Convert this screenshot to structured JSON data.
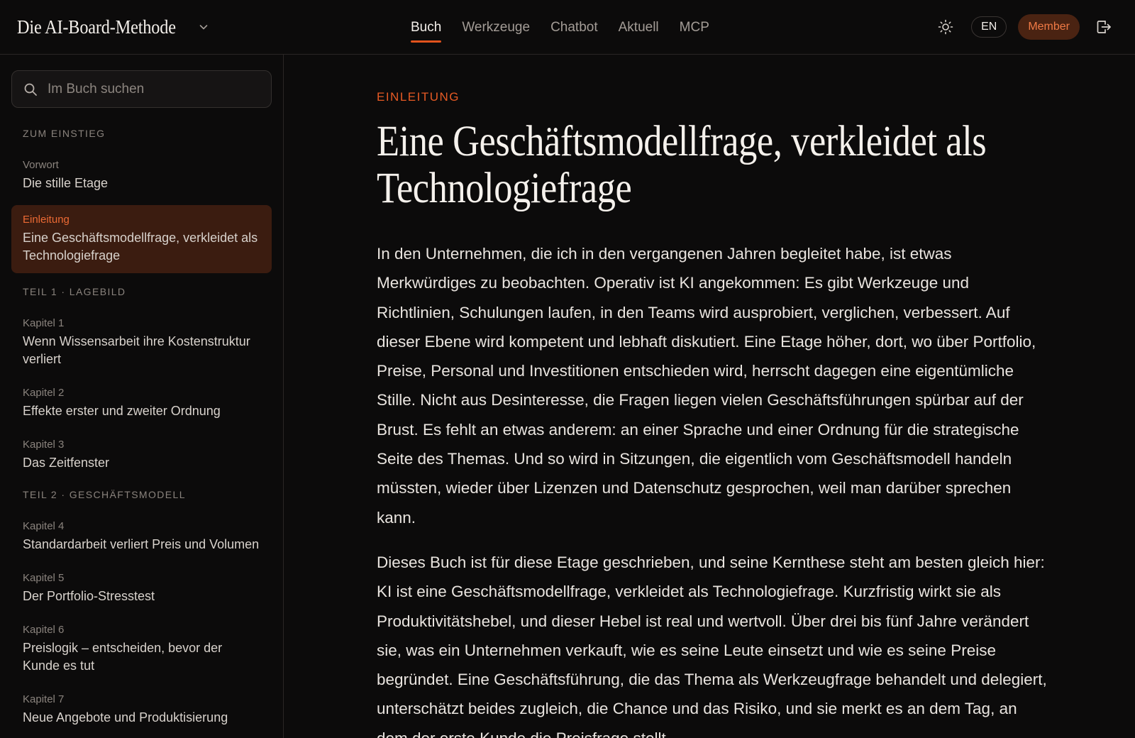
{
  "header": {
    "brand_title": "Die AI-Board-Methode",
    "brand_chevron_icon": "chevron-down-icon",
    "nav": [
      {
        "label": "Buch",
        "active": true
      },
      {
        "label": "Werkzeuge",
        "active": false
      },
      {
        "label": "Chatbot",
        "active": false
      },
      {
        "label": "Aktuell",
        "active": false
      },
      {
        "label": "MCP",
        "active": false
      }
    ],
    "theme_icon": "sun-icon",
    "language_label": "EN",
    "member_label": "Member",
    "logout_icon": "logout-icon",
    "accent_color": "#e2531d"
  },
  "sidebar": {
    "search": {
      "placeholder": "Im Buch suchen",
      "value": "",
      "icon": "search-icon"
    },
    "sections": [
      {
        "label": "ZUM EINSTIEG"
      },
      {
        "label": "TEIL 1 · LAGEBILD"
      },
      {
        "label": "TEIL 2 · GESCHÄFTSMODELL"
      }
    ],
    "items": [
      {
        "kicker": "Vorwort",
        "title": "Die stille Etage"
      },
      {
        "kicker": "Einleitung",
        "title": "Eine Geschäftsmodellfrage, verkleidet als Technologiefrage",
        "active": true
      },
      {
        "kicker": "Kapitel 1",
        "title": "Wenn Wissensarbeit ihre Kostenstruktur verliert"
      },
      {
        "kicker": "Kapitel 2",
        "title": "Effekte erster und zweiter Ordnung"
      },
      {
        "kicker": "Kapitel 3",
        "title": "Das Zeitfenster"
      },
      {
        "kicker": "Kapitel 4",
        "title": "Standardarbeit verliert Preis und Volumen"
      },
      {
        "kicker": "Kapitel 5",
        "title": "Der Portfolio-Stresstest"
      },
      {
        "kicker": "Kapitel 6",
        "title": "Preislogik – entscheiden, bevor der Kunde es tut"
      },
      {
        "kicker": "Kapitel 7",
        "title": "Neue Angebote und Produktisierung"
      }
    ]
  },
  "article": {
    "eyebrow": "EINLEITUNG",
    "title": "Eine Geschäftsmodellfrage, verkleidet als Technologiefrage",
    "paragraphs": [
      "In den Unternehmen, die ich in den vergangenen Jahren begleitet habe, ist etwas Merkwürdiges zu beobachten. Operativ ist KI angekommen: Es gibt Werkzeuge und Richtlinien, Schulungen laufen, in den Teams wird ausprobiert, verglichen, verbessert. Auf dieser Ebene wird kompetent und lebhaft diskutiert. Eine Etage höher, dort, wo über Portfolio, Preise, Personal und Investitionen entschieden wird, herrscht dagegen eine eigentümliche Stille. Nicht aus Desinteresse, die Fragen liegen vielen Geschäftsführungen spürbar auf der Brust. Es fehlt an etwas anderem: an einer Sprache und einer Ordnung für die strategische Seite des Themas. Und so wird in Sitzungen, die eigentlich vom Geschäftsmodell handeln müssten, wieder über Lizenzen und Datenschutz gesprochen, weil man darüber sprechen kann.",
      "Dieses Buch ist für diese Etage geschrieben, und seine Kernthese steht am besten gleich hier: KI ist eine Geschäftsmodellfrage, verkleidet als Technologiefrage. Kurzfristig wirkt sie als Produktivitätshebel, und dieser Hebel ist real und wertvoll. Über drei bis fünf Jahre verändert sie, was ein Unternehmen verkauft, wie es seine Leute einsetzt und wie es seine Preise begründet. Eine Geschäftsführung, die das Thema als Werkzeugfrage behandelt und delegiert, unterschätzt beides zugleich, die Chance und das Risiko, und sie merkt es an dem Tag, an dem der erste Kunde die Preisfrage stellt."
    ]
  }
}
